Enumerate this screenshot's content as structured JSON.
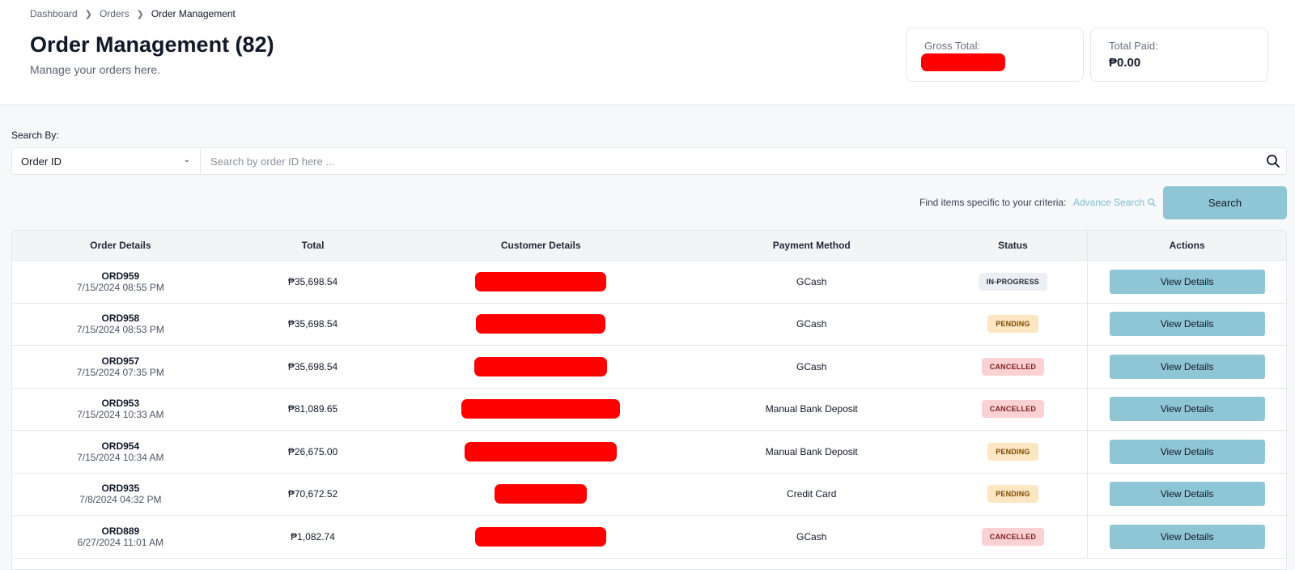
{
  "breadcrumb": {
    "items": [
      "Dashboard",
      "Orders",
      "Order Management"
    ]
  },
  "header": {
    "title": "Order Management (82)",
    "subtitle": "Manage your orders here."
  },
  "stats": {
    "gross_total_label": "Gross Total:",
    "total_paid_label": "Total Paid:",
    "total_paid_value": "₱0.00"
  },
  "search": {
    "label": "Search By:",
    "selected_field": "Order ID",
    "placeholder": "Search by order ID here ...",
    "criteria_text": "Find items specific to your criteria:",
    "advance_link": "Advance Search",
    "button_label": "Search"
  },
  "table": {
    "columns": [
      "Order Details",
      "Total",
      "Customer Details",
      "Payment Method",
      "Status",
      "Actions"
    ],
    "rows": [
      {
        "order_id": "ORD959",
        "date": "7/15/2024 08:55 PM",
        "total": "₱35,698.54",
        "payment": "GCash",
        "status": "IN-PROGRESS",
        "status_kind": "in-progress",
        "action": "View Details"
      },
      {
        "order_id": "ORD958",
        "date": "7/15/2024 08:53 PM",
        "total": "₱35,698.54",
        "payment": "GCash",
        "status": "PENDING",
        "status_kind": "pending",
        "action": "View Details"
      },
      {
        "order_id": "ORD957",
        "date": "7/15/2024 07:35 PM",
        "total": "₱35,698.54",
        "payment": "GCash",
        "status": "CANCELLED",
        "status_kind": "cancelled",
        "action": "View Details"
      },
      {
        "order_id": "ORD953",
        "date": "7/15/2024 10:33 AM",
        "total": "₱81,089.65",
        "payment": "Manual Bank Deposit",
        "status": "CANCELLED",
        "status_kind": "cancelled",
        "action": "View Details"
      },
      {
        "order_id": "ORD954",
        "date": "7/15/2024 10:34 AM",
        "total": "₱26,675.00",
        "payment": "Manual Bank Deposit",
        "status": "PENDING",
        "status_kind": "pending",
        "action": "View Details"
      },
      {
        "order_id": "ORD935",
        "date": "7/8/2024 04:32 PM",
        "total": "₱70,672.52",
        "payment": "Credit Card",
        "status": "PENDING",
        "status_kind": "pending",
        "action": "View Details"
      },
      {
        "order_id": "ORD889",
        "date": "6/27/2024 11:01 AM",
        "total": "₱1,082.74",
        "payment": "GCash",
        "status": "CANCELLED",
        "status_kind": "cancelled",
        "action": "View Details"
      }
    ]
  },
  "colors": {
    "accent": "#8fc6d5",
    "redaction": "#ff0000",
    "link": "#7fbdd0"
  }
}
